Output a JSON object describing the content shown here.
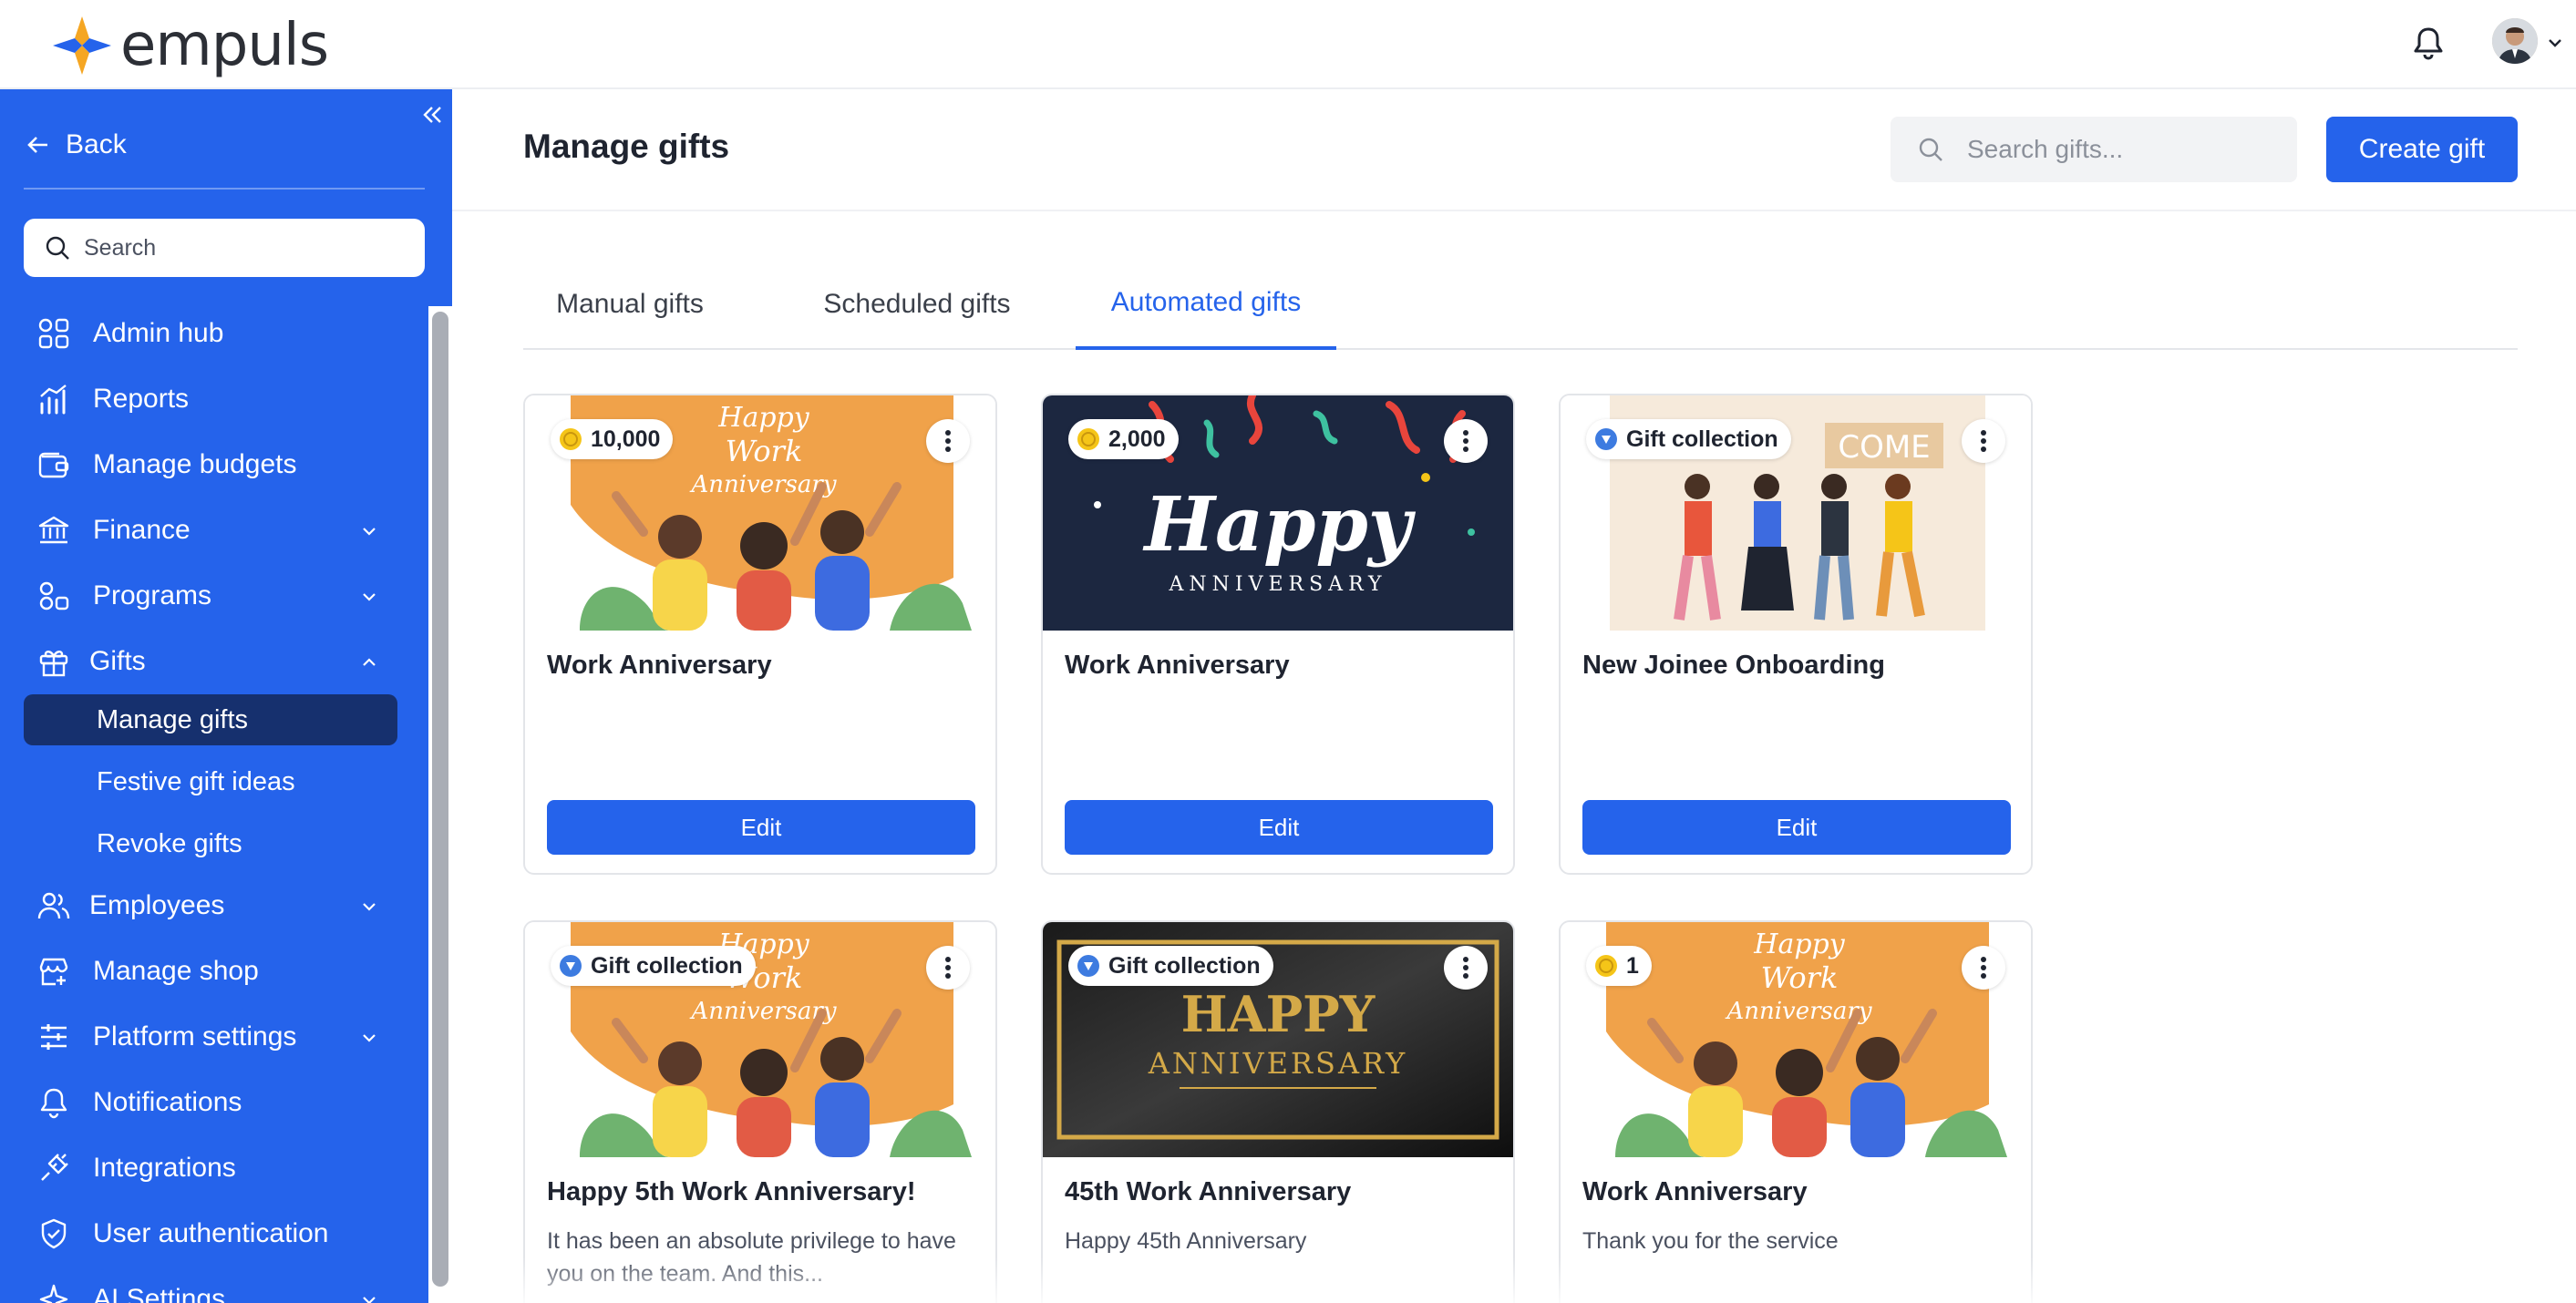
{
  "app": {
    "brand": "empuls"
  },
  "sidebar": {
    "back_label": "Back",
    "search_placeholder": "Search",
    "items": [
      {
        "label": "Admin hub",
        "icon": "grid-icon"
      },
      {
        "label": "Reports",
        "icon": "chart-icon"
      },
      {
        "label": "Manage budgets",
        "icon": "wallet-icon"
      },
      {
        "label": "Finance",
        "icon": "bank-icon"
      },
      {
        "label": "Programs",
        "icon": "programs-icon"
      },
      {
        "label": "Gifts",
        "icon": "gift-icon"
      },
      {
        "label": "Employees",
        "icon": "users-icon"
      },
      {
        "label": "Manage shop",
        "icon": "shop-icon"
      },
      {
        "label": "Platform settings",
        "icon": "sliders-icon"
      },
      {
        "label": "Notifications",
        "icon": "bell-icon"
      },
      {
        "label": "Integrations",
        "icon": "plug-icon"
      },
      {
        "label": "User authentication",
        "icon": "shield-icon"
      },
      {
        "label": "AI Settings",
        "icon": "sparkle-icon"
      }
    ],
    "gifts_subitems": [
      {
        "label": "Manage gifts",
        "active": true
      },
      {
        "label": "Festive gift ideas",
        "active": false
      },
      {
        "label": "Revoke gifts",
        "active": false
      }
    ]
  },
  "header": {
    "title": "Manage gifts",
    "search_placeholder": "Search gifts...",
    "create_label": "Create gift"
  },
  "tabs": [
    {
      "label": "Manual gifts",
      "active": false
    },
    {
      "label": "Scheduled gifts",
      "active": false
    },
    {
      "label": "Automated gifts",
      "active": true
    }
  ],
  "cards": [
    {
      "badge": "10,000",
      "badge_type": "coin",
      "title": "Work Anniversary",
      "description": "",
      "edit_label": "Edit",
      "image_text": [
        "Happy",
        "Work",
        "Anniversary"
      ]
    },
    {
      "badge": "2,000",
      "badge_type": "coin",
      "title": "Work Anniversary",
      "description": "",
      "edit_label": "Edit",
      "image_text": [
        "Happy",
        "ANNIVERSARY"
      ]
    },
    {
      "badge": "Gift collection",
      "badge_type": "collection",
      "title": "New Joinee Onboarding",
      "description": "",
      "edit_label": "Edit",
      "image_text": [
        "COME"
      ]
    },
    {
      "badge": "Gift collection",
      "badge_type": "collection",
      "title": "Happy 5th Work Anniversary!",
      "description": "It has been an absolute privilege to have you on the team. And this...",
      "edit_label": "",
      "image_text": [
        "Happy",
        "Work",
        "Anniversary"
      ]
    },
    {
      "badge": "Gift collection",
      "badge_type": "collection",
      "title": "45th Work Anniversary",
      "description": "Happy 45th Anniversary",
      "edit_label": "",
      "image_text": [
        "HAPPY",
        "ANNIVERSARY"
      ]
    },
    {
      "badge": "1",
      "badge_type": "coin",
      "title": "Work Anniversary",
      "description": "Thank you for the service",
      "edit_label": "",
      "image_text": [
        "Happy",
        "Work",
        "Anniversary"
      ]
    }
  ],
  "colors": {
    "primary": "#2563eb",
    "sidebar_active": "#16306e",
    "coin": "#f5c518"
  }
}
